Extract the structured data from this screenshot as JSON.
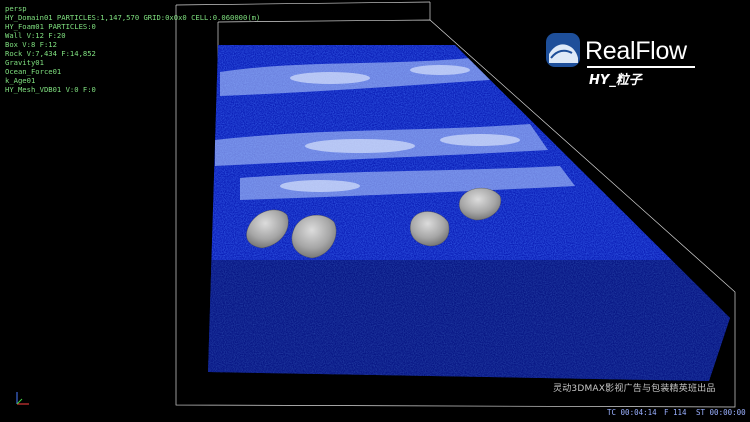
{
  "viewport": {
    "label": "persp"
  },
  "scene_info": [
    "HY_Domain01 PARTICLES:1,147,570 GRID:0x0x0 CELL:0.060000(m)",
    "HY_Foam01 PARTICLES:0",
    "Wall V:12 F:20",
    "Box V:8 F:12",
    "Rock V:7,434 F:14,852",
    "Gravity01",
    "Ocean_Force01",
    "k_Age01",
    "HY_Mesh_VDB01 V:0 F:0"
  ],
  "logo": {
    "brand": "RealFlow",
    "subtitle": "HY_粒子",
    "icon": "realflow-wave-icon"
  },
  "watermark": "灵动3DMAX影视广告与包装精英班出品",
  "status": {
    "tc": "TC 00:04:14",
    "frame": "F 114",
    "st": "ST 00:00:00"
  },
  "colors": {
    "hud_text": "#7fe07f",
    "water": "#1f3cff",
    "foam": "#cfe2ff",
    "rock": "#a9a9a9"
  }
}
